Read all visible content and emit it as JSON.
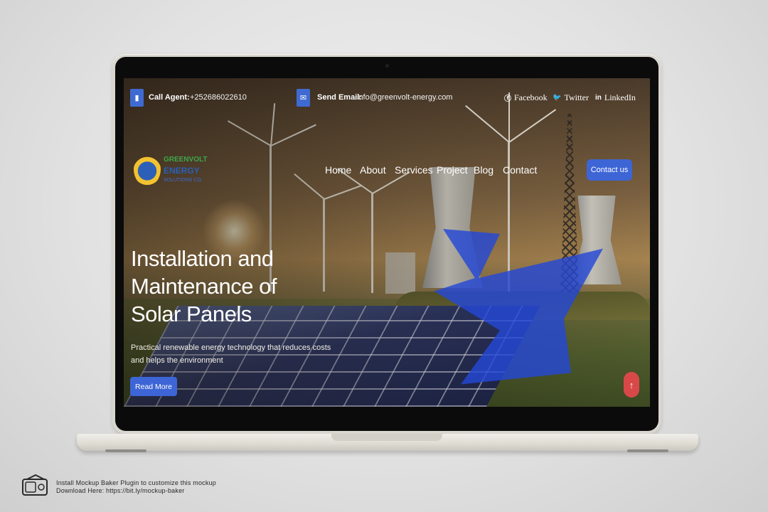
{
  "topbar": {
    "call_label": "Call Agent:",
    "call_value": "+252686022610",
    "email_label": "Send Email:",
    "email_value": "info@greenvolt-energy.com",
    "social": [
      {
        "icon": "facebook-icon",
        "label": "Facebook"
      },
      {
        "icon": "twitter-icon",
        "label": "Twitter"
      },
      {
        "icon": "linkedin-icon",
        "label": "LinkedIn"
      }
    ]
  },
  "logo": {
    "line1": "GREENVOLT",
    "line2": "ENERGY",
    "line3": "SOLUTIONS CO."
  },
  "nav": {
    "items": [
      "Home",
      "About",
      "Services",
      "Project",
      "Blog",
      "Contact"
    ],
    "cta": "Contact us"
  },
  "hero": {
    "title_lines": [
      "Installation and",
      "Maintenance of",
      "Solar Panels"
    ],
    "subtitle": "Practical renewable energy technology that reduces costs and helps the environment",
    "button": "Read More"
  },
  "footer_note": {
    "line1": "Install Mockup Baker Plugin to customize this mockup",
    "line2": "Download Here: https://bit.ly/mockup-baker"
  },
  "colors": {
    "accent_blue": "#3d65d6",
    "scroll_top_red": "#d94848"
  }
}
